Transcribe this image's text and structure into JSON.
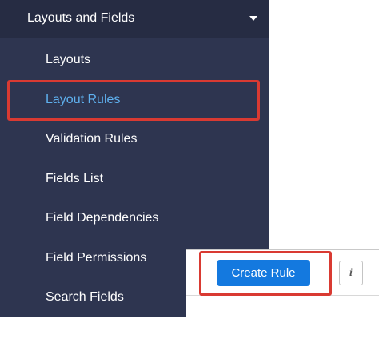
{
  "sidebar": {
    "section_title": "Layouts and Fields",
    "items": [
      {
        "label": "Layouts",
        "active": false
      },
      {
        "label": "Layout Rules",
        "active": true
      },
      {
        "label": "Validation Rules",
        "active": false
      },
      {
        "label": "Fields List",
        "active": false
      },
      {
        "label": "Field Dependencies",
        "active": false
      },
      {
        "label": "Field Permissions",
        "active": false
      },
      {
        "label": "Search Fields",
        "active": false
      }
    ]
  },
  "panel": {
    "create_label": "Create Rule",
    "info_label": "i"
  },
  "colors": {
    "sidebar_bg": "#2e3550",
    "header_bg": "#262c43",
    "active_text": "#5fb1ef",
    "button_blue": "#1479df",
    "highlight_red": "#d93a32"
  },
  "icons": {
    "caret": "caret-down-icon",
    "info": "info-icon"
  }
}
